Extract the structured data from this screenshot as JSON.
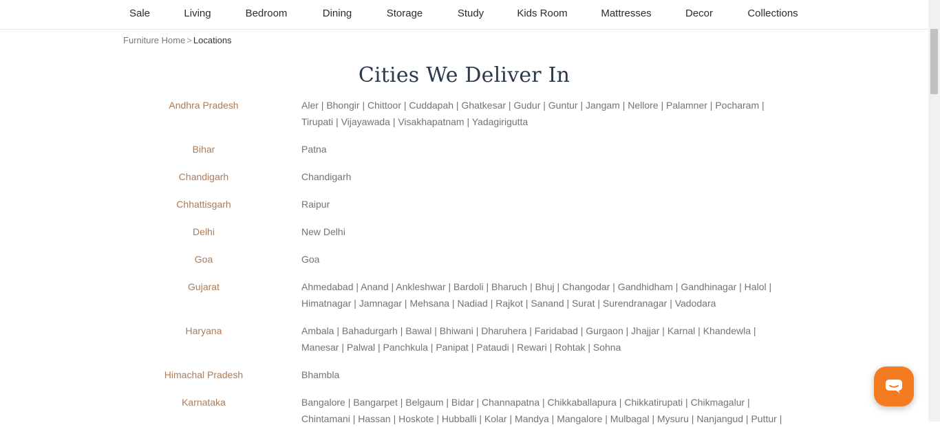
{
  "nav": {
    "items": [
      "Sale",
      "Living",
      "Bedroom",
      "Dining",
      "Storage",
      "Study",
      "Kids Room",
      "Mattresses",
      "Decor",
      "Collections"
    ]
  },
  "breadcrumb": {
    "home": "Furniture Home",
    "separator": ">",
    "current": "Locations"
  },
  "page_title": "Cities We Deliver In",
  "locations": [
    {
      "state": "Andhra Pradesh",
      "lines": [
        "Aler | Bhongir | Chittoor | Cuddapah | Ghatkesar | Gudur | Guntur | Jangam | Nellore | Palamner | Pocharam |",
        "Tirupati | Vijayawada | Visakhapatnam | Yadagirigutta"
      ]
    },
    {
      "state": "Bihar",
      "lines": [
        "Patna"
      ]
    },
    {
      "state": "Chandigarh",
      "lines": [
        "Chandigarh"
      ]
    },
    {
      "state": "Chhattisgarh",
      "lines": [
        "Raipur"
      ]
    },
    {
      "state": "Delhi",
      "lines": [
        "New Delhi"
      ]
    },
    {
      "state": "Goa",
      "lines": [
        "Goa"
      ]
    },
    {
      "state": "Gujarat",
      "lines": [
        "Ahmedabad | Anand | Ankleshwar | Bardoli | Bharuch | Bhuj | Changodar | Gandhidham | Gandhinagar | Halol |",
        "Himatnagar | Jamnagar | Mehsana | Nadiad | Rajkot | Sanand | Surat | Surendranagar | Vadodara"
      ]
    },
    {
      "state": "Haryana",
      "lines": [
        "Ambala | Bahadurgarh | Bawal | Bhiwani | Dharuhera | Faridabad | Gurgaon | Jhajjar | Karnal | Khandewla |",
        "Manesar | Palwal | Panchkula | Panipat | Pataudi | Rewari | Rohtak | Sohna"
      ]
    },
    {
      "state": "Himachal Pradesh",
      "lines": [
        "Bhambla"
      ]
    },
    {
      "state": "Karnataka",
      "lines": [
        "Bangalore | Bangarpet | Belgaum | Bidar | Channapatna | Chikkaballapura | Chikkatirupati | Chikmagalur |",
        "Chintamani | Hassan | Hoskote | Hubballi | Kolar | Mandya | Mangalore | Mulbagal | Mysuru | Nanjangud | Puttur |"
      ]
    }
  ],
  "chat": {
    "icon": "chat-bubble-icon",
    "color": "#f47b20"
  }
}
